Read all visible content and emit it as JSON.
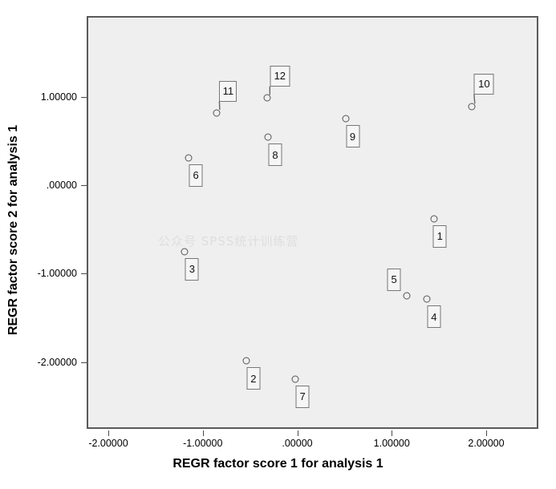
{
  "chart_data": {
    "type": "scatter",
    "title": "",
    "xlabel": "REGR factor score   1 for analysis 1",
    "ylabel": "REGR factor score   2 for analysis 1",
    "xlim": [
      -2.45,
      2.55
    ],
    "ylim": [
      -2.0,
      1.63
    ],
    "grid": false,
    "legend": null,
    "xticks": [
      "-2.00000",
      "-1.00000",
      ".00000",
      "1.00000",
      "2.00000"
    ],
    "xtick_values": [
      -2,
      -1,
      0,
      1,
      2
    ],
    "yticks": [
      "1.00000",
      ".00000",
      "-1.00000",
      "-2.00000"
    ],
    "ytick_values": [
      1,
      0,
      -1,
      -2
    ],
    "point_label_field": "case number",
    "points": [
      {
        "label": "1",
        "x": 1.45,
        "y": -0.38
      },
      {
        "label": "2",
        "x": -0.54,
        "y": -1.99
      },
      {
        "label": "3",
        "x": -1.19,
        "y": -0.75
      },
      {
        "label": "4",
        "x": 1.37,
        "y": -1.29
      },
      {
        "label": "5",
        "x": 1.16,
        "y": -1.25
      },
      {
        "label": "6",
        "x": -1.15,
        "y": 0.31
      },
      {
        "label": "7",
        "x": -0.02,
        "y": -2.19
      },
      {
        "label": "8",
        "x": -0.31,
        "y": 0.54
      },
      {
        "label": "9",
        "x": 0.51,
        "y": 0.75
      },
      {
        "label": "10",
        "x": 1.85,
        "y": 0.89
      },
      {
        "label": "11",
        "x": -0.85,
        "y": 0.82
      },
      {
        "label": "12",
        "x": -0.32,
        "y": 0.99
      }
    ]
  },
  "watermark": {
    "text": "公众号 SPSS统计训练营"
  },
  "colors": {
    "plot_background": "#efefef",
    "plot_border": "#5a5a5a",
    "marker_stroke": "#555555",
    "label_border": "#777777",
    "label_background": "#f6f6f6",
    "text": "#000000",
    "watermark": "#dedede"
  }
}
